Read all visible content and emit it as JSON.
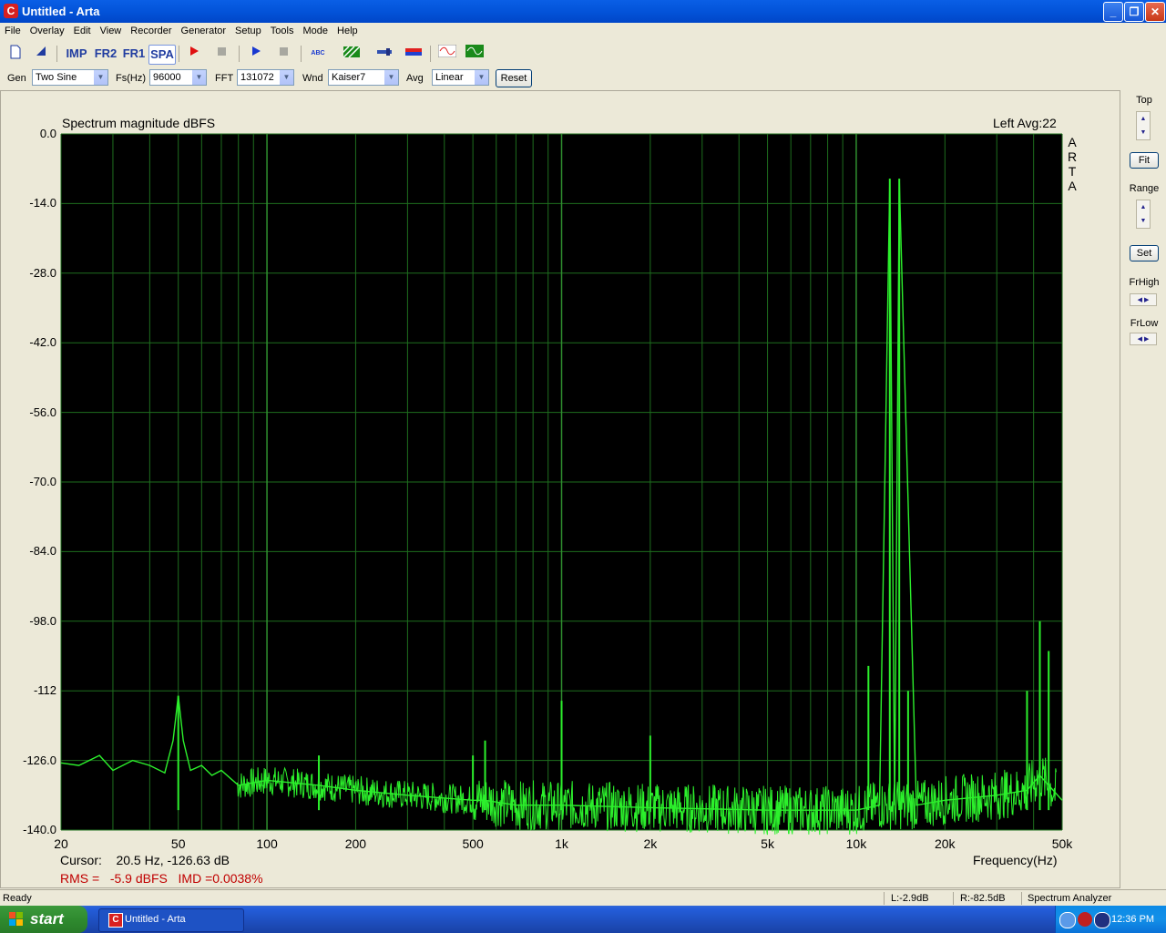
{
  "window": {
    "title": "Untitled - Arta",
    "icon_letter": "C"
  },
  "menu": [
    "File",
    "Overlay",
    "Edit",
    "View",
    "Recorder",
    "Generator",
    "Setup",
    "Tools",
    "Mode",
    "Help"
  ],
  "toolbar": {
    "imp": "IMP",
    "fr2": "FR2",
    "fr1": "FR1",
    "spa": "SPA",
    "abc": "ABC"
  },
  "settings": {
    "gen_label": "Gen",
    "gen_value": "Two Sine",
    "fs_label": "Fs(Hz)",
    "fs_value": "96000",
    "fft_label": "FFT",
    "fft_value": "131072",
    "wnd_label": "Wnd",
    "wnd_value": "Kaiser7",
    "avg_label": "Avg",
    "avg_value": "Linear",
    "reset_label": "Reset"
  },
  "plot": {
    "title": "Spectrum magnitude dBFS",
    "channel_avg": "Left  Avg:22",
    "brand_vertical": [
      "A",
      "R",
      "T",
      "A"
    ],
    "cursor_text": "Cursor:    20.5 Hz, -126.63 dB",
    "freq_axis_label": "Frequency(Hz)",
    "rms_text": "RMS =   -5.9 dBFS   IMD =0.0038%",
    "y_ticks": [
      "0.0",
      "-14.0",
      "-28.0",
      "-42.0",
      "-56.0",
      "-70.0",
      "-84.0",
      "-98.0",
      "-112",
      "-126.0",
      "-140.0"
    ],
    "x_ticks": [
      "20",
      "50",
      "100",
      "200",
      "500",
      "1k",
      "2k",
      "5k",
      "10k",
      "20k",
      "50k"
    ],
    "colors": {
      "background": "#000000",
      "grid": "#1e6e1e",
      "grid_major": "#2f8f2f",
      "trace": "#2cf02c"
    }
  },
  "chart_data": {
    "type": "line",
    "title": "Spectrum magnitude dBFS",
    "xlabel": "Frequency(Hz)",
    "ylabel": "",
    "xscale": "log",
    "xlim": [
      20,
      50000
    ],
    "ylim": [
      -140,
      0
    ],
    "grid": true,
    "series": [
      {
        "x": [
          20,
          23,
          27,
          30,
          35,
          40,
          45,
          48,
          50,
          52,
          55,
          60,
          65,
          70,
          80,
          100,
          150,
          200,
          300,
          500,
          550,
          700,
          1000,
          2000,
          5000,
          10000,
          12000,
          13000,
          13500,
          14000,
          16000,
          20000,
          30000,
          38000,
          42000,
          45000,
          50000
        ],
        "y": [
          -126.5,
          -127,
          -125,
          -128,
          -126,
          -127,
          -128.5,
          -122,
          -113,
          -122,
          -128,
          -127,
          -129,
          -128,
          -131,
          -130,
          -131,
          -132,
          -133,
          -134,
          -134,
          -135,
          -135,
          -135.5,
          -136,
          -136,
          -135,
          -9,
          -135,
          -9,
          -135,
          -134,
          -133,
          -132,
          -129,
          -131,
          -134
        ]
      }
    ],
    "peaks": [
      {
        "x": 50,
        "y": -113
      },
      {
        "x": 150,
        "y": -125
      },
      {
        "x": 500,
        "y": -125
      },
      {
        "x": 550,
        "y": -122
      },
      {
        "x": 1000,
        "y": -114
      },
      {
        "x": 2000,
        "y": -121
      },
      {
        "x": 11000,
        "y": -107
      },
      {
        "x": 13000,
        "y": -9
      },
      {
        "x": 14000,
        "y": -9
      },
      {
        "x": 15000,
        "y": -112
      },
      {
        "x": 38000,
        "y": -112
      },
      {
        "x": 42000,
        "y": -98
      },
      {
        "x": 45000,
        "y": -104
      }
    ]
  },
  "right_panel": {
    "top": "Top",
    "fit": "Fit",
    "range": "Range",
    "set": "Set",
    "frhigh": "FrHigh",
    "frlow": "FrLow"
  },
  "status": {
    "ready": "Ready",
    "l": "L:-2.9dB",
    "r": "R:-82.5dB",
    "mode": "Spectrum Analyzer"
  },
  "taskbar": {
    "start": "start",
    "task": "Untitled - Arta",
    "clock": "12:36 PM"
  }
}
